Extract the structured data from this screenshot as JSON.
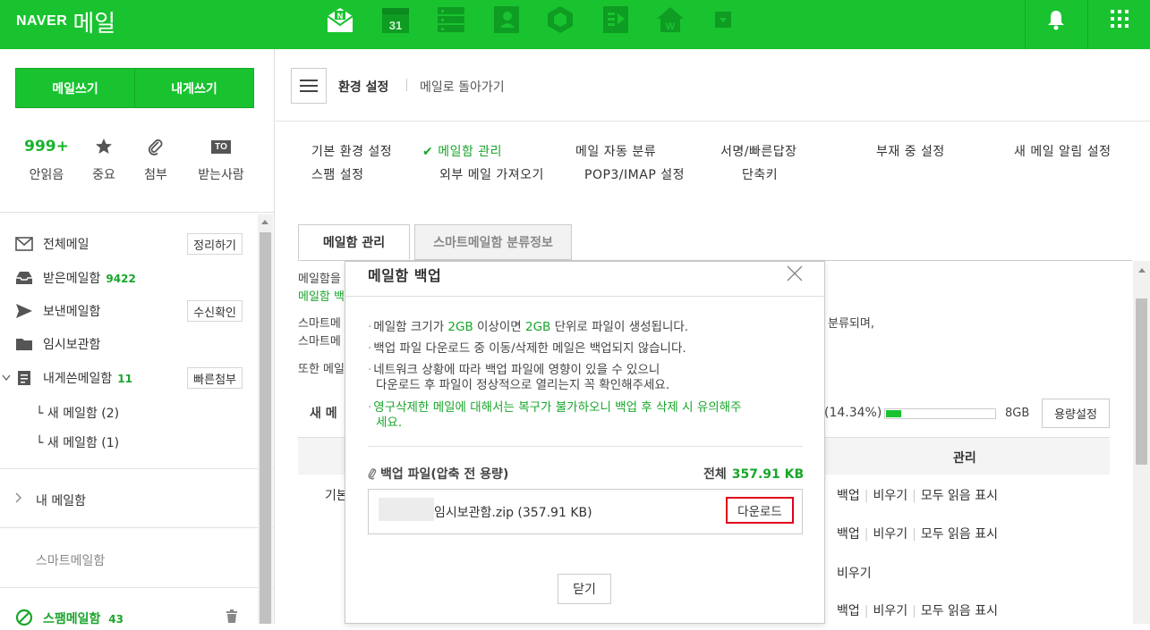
{
  "topbar": {
    "logo_brand": "NAVER",
    "logo_service": "메일",
    "apps": [
      "naver-mail-icon",
      "calendar-icon",
      "list-icon",
      "contacts-icon",
      "box-icon",
      "office-icon",
      "blog-icon",
      "more-dropdown-icon"
    ],
    "calendar_day": "31",
    "colors": {
      "brand": "#19c330"
    }
  },
  "sidebar": {
    "write_mail": "메일쓰기",
    "write_self": "내게쓰기",
    "quick": [
      {
        "value": "999+",
        "label": "안읽음"
      },
      {
        "icon": "star-icon",
        "label": "중요"
      },
      {
        "icon": "paperclip-icon",
        "label": "첨부"
      },
      {
        "icon": "to-icon",
        "icon_text": "TO",
        "label": "받는사람"
      }
    ],
    "folders": {
      "all": {
        "label": "전체메일",
        "button": "정리하기"
      },
      "inbox": {
        "label": "받은메일함",
        "count": "9422"
      },
      "sent": {
        "label": "보낸메일함",
        "button": "수신확인"
      },
      "drafts": {
        "label": "임시보관함"
      },
      "self": {
        "label": "내게쓴메일함",
        "count": "11",
        "button": "빠른첨부"
      },
      "sub1": "└ 새 메일함 (2)",
      "sub2": "└ 새 메일함 (1)",
      "my": "내 메일함",
      "smart": "스마트메일함",
      "spam": {
        "label": "스팸메일함",
        "count": "43"
      }
    }
  },
  "main": {
    "header": {
      "title": "환경 설정",
      "back": "메일로 돌아가기"
    },
    "settings_nav": [
      "기본 환경 설정",
      "메일함 관리",
      "메일 자동 분류",
      "서명/빠른답장",
      "부재 중 설정",
      "새 메일 알림 설정",
      "스팸 설정",
      "외부 메일 가져오기",
      "POP3/IMAP 설정",
      "단축키"
    ],
    "tabs": [
      "메일함 관리",
      "스마트메일함 분류정보"
    ],
    "bg": {
      "l1": "메일함을",
      "l2": "메일함 백",
      "l3": "스마트메",
      "l3r": "분류되며,",
      "l4": "스마트메",
      "l5": "또한 메일",
      "new_mailbox": "새 메",
      "quota_text": "(14.34%)",
      "quota_fraction": 0.1434,
      "quota_max": "8GB",
      "quota_button": "용량설정",
      "col_manage": "관리",
      "row_label": "기본",
      "act_backup": "백업",
      "act_empty": "비우기",
      "act_read_all": "모두 읽음 표시"
    }
  },
  "modal": {
    "title": "메일함 백업",
    "notices": {
      "n1a": "메일함 크기가 ",
      "n1g1": "2GB",
      "n1b": " 이상이면 ",
      "n1g2": "2GB",
      "n1c": " 단위로 파일이 생성됩니다.",
      "n2": "백업 파일 다운로드 중 이동/삭제한 메일은 백업되지 않습니다.",
      "n3a": "네트워크 상황에 따라 백업 파일에 영향이 있을 수 있으니",
      "n3b": "다운로드 후 파일이 정상적으로 열리는지 꼭 확인해주세요.",
      "n4a": "영구삭제한 메일에 대해서는 복구가 불가하오니 백업 후 삭제 시 유의해주",
      "n4b": "세요."
    },
    "backup_title": "백업 파일(압축 전 용량)",
    "total_label": "전체",
    "total_value": "357.91 KB",
    "file_name": "임시보관함.zip (357.91 KB)",
    "download": "다운로드",
    "close": "닫기"
  }
}
